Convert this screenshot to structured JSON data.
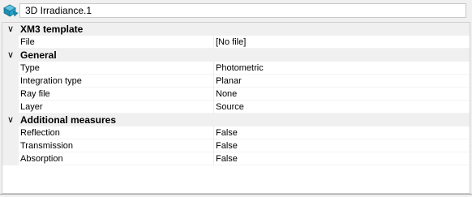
{
  "title": {
    "text": "3D Irradiance.1",
    "icon": "irradiance-sensor-icon"
  },
  "categories": [
    {
      "label": "XM3 template",
      "chevron": "∨",
      "properties": [
        {
          "name": "File",
          "value": "[No file]"
        }
      ]
    },
    {
      "label": "General",
      "chevron": "∨",
      "properties": [
        {
          "name": "Type",
          "value": "Photometric"
        },
        {
          "name": "Integration type",
          "value": "Planar"
        },
        {
          "name": "Ray file",
          "value": "None"
        },
        {
          "name": "Layer",
          "value": "Source"
        }
      ]
    },
    {
      "label": "Additional measures",
      "chevron": "∨",
      "properties": [
        {
          "name": "Reflection",
          "value": "False"
        },
        {
          "name": "Transmission",
          "value": "False"
        },
        {
          "name": "Absorption",
          "value": "False"
        }
      ]
    }
  ],
  "colors": {
    "icon_primary": "#1a8fb3",
    "icon_secondary": "#5fc3e0",
    "category_bg": "#f0f0f0"
  }
}
